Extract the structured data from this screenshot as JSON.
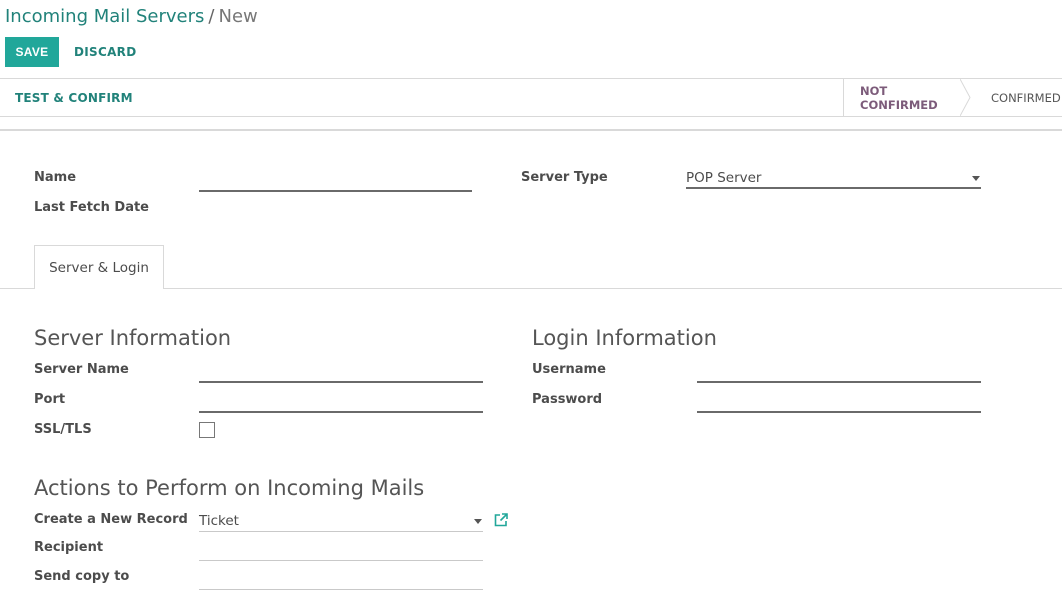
{
  "breadcrumb": {
    "parent": "Incoming Mail Servers",
    "separator": "/",
    "current": "New"
  },
  "toolbar": {
    "save_label": "SAVE",
    "discard_label": "DISCARD"
  },
  "statusbar": {
    "test_confirm_label": "TEST & CONFIRM",
    "stage_active": "NOT CONFIRMED",
    "stage_next": "CONFIRMED"
  },
  "form": {
    "name_label": "Name",
    "name_value": "",
    "last_fetch_label": "Last Fetch Date",
    "server_type_label": "Server Type",
    "server_type_value": "POP Server"
  },
  "tabs": [
    {
      "label": "Server & Login",
      "active": true
    }
  ],
  "server_info": {
    "title": "Server Information",
    "server_name_label": "Server Name",
    "port_label": "Port",
    "ssl_label": "SSL/TLS",
    "ssl_checked": false
  },
  "login_info": {
    "title": "Login Information",
    "username_label": "Username",
    "password_label": "Password"
  },
  "actions": {
    "title": "Actions to Perform on Incoming Mails",
    "create_record_label": "Create a New Record",
    "create_record_value": "Ticket",
    "recipient_label": "Recipient",
    "send_copy_label": "Send copy to"
  },
  "colors": {
    "accent": "#21a79a",
    "link": "#21827a",
    "stage_active": "#7c5b7a"
  },
  "icons": {
    "dropdown": "chevron-down-icon",
    "external": "external-link-icon"
  }
}
